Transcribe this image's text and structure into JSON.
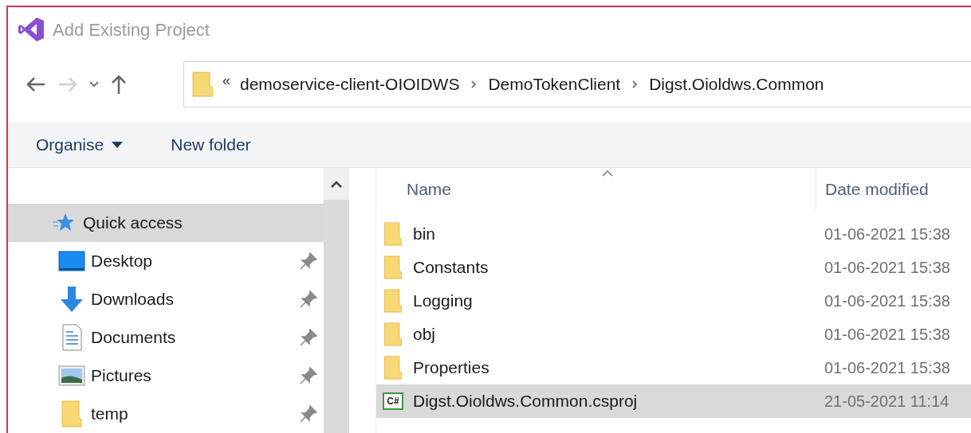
{
  "window": {
    "title": "Add Existing Project"
  },
  "address_bar": {
    "overflow": "«",
    "path": [
      "demoservice-client-OIOIDWS",
      "DemoTokenClient",
      "Digst.Oioldws.Common"
    ]
  },
  "nav": {
    "back_disabled": false,
    "forward_disabled": true
  },
  "toolbar": {
    "organise": "Organise",
    "new_folder": "New folder"
  },
  "sidebar": {
    "items": [
      {
        "kind": "quick",
        "label": "Quick access",
        "selected": true,
        "pinned": false
      },
      {
        "kind": "desktop",
        "label": "Desktop",
        "selected": false,
        "pinned": true
      },
      {
        "kind": "downloads",
        "label": "Downloads",
        "selected": false,
        "pinned": true
      },
      {
        "kind": "documents",
        "label": "Documents",
        "selected": false,
        "pinned": true
      },
      {
        "kind": "pictures",
        "label": "Pictures",
        "selected": false,
        "pinned": true
      },
      {
        "kind": "folder",
        "label": "temp",
        "selected": false,
        "pinned": true
      }
    ]
  },
  "file_list": {
    "columns": [
      "Name",
      "Date modified"
    ],
    "rows": [
      {
        "kind": "folder",
        "name": "bin",
        "date": "01-06-2021 15:38",
        "selected": false
      },
      {
        "kind": "folder",
        "name": "Constants",
        "date": "01-06-2021 15:38",
        "selected": false
      },
      {
        "kind": "folder",
        "name": "Logging",
        "date": "01-06-2021 15:38",
        "selected": false
      },
      {
        "kind": "folder",
        "name": "obj",
        "date": "01-06-2021 15:38",
        "selected": false
      },
      {
        "kind": "folder",
        "name": "Properties",
        "date": "01-06-2021 15:38",
        "selected": false
      },
      {
        "kind": "csproj",
        "icon_text": "C#",
        "name": "Digst.Oioldws.Common.csproj",
        "date": "21-05-2021 11:14",
        "selected": true
      }
    ]
  }
}
